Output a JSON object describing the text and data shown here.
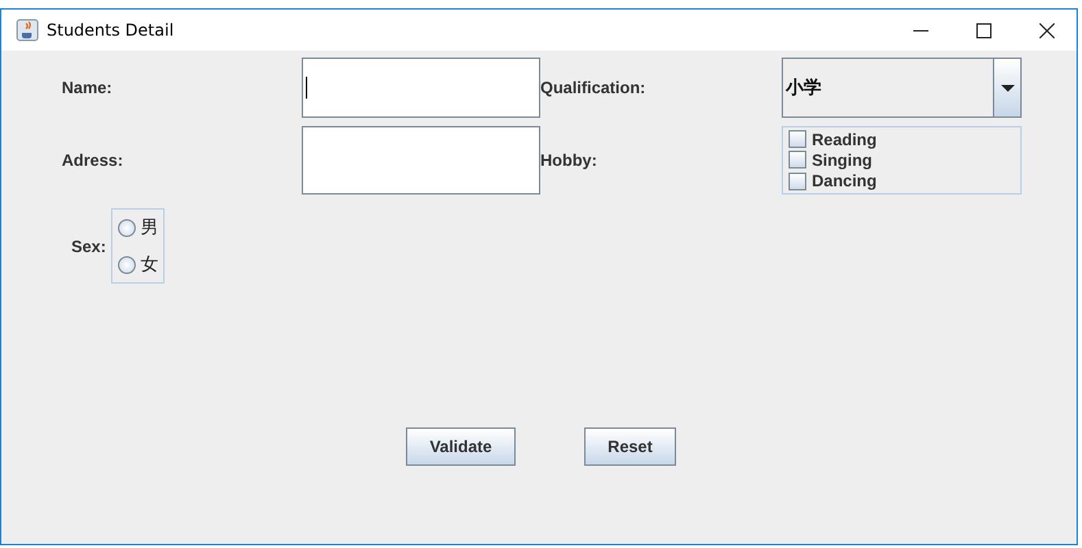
{
  "window": {
    "title": "Students Detail"
  },
  "form": {
    "name": {
      "label": "Name:",
      "focused": true
    },
    "qualification": {
      "label": "Qualification:",
      "value": "小学"
    },
    "address": {
      "label": "Adress:",
      "focused": false
    },
    "hobby": {
      "label": "Hobby:",
      "options": [
        {
          "label": "Reading",
          "checked": false
        },
        {
          "label": "Singing",
          "checked": false
        },
        {
          "label": "Dancing",
          "checked": false
        }
      ]
    },
    "sex": {
      "label": "Sex:",
      "options": [
        {
          "label": "男",
          "selected": false
        },
        {
          "label": "女",
          "selected": false
        }
      ]
    }
  },
  "buttons": [
    "Validate",
    "Reset"
  ]
}
